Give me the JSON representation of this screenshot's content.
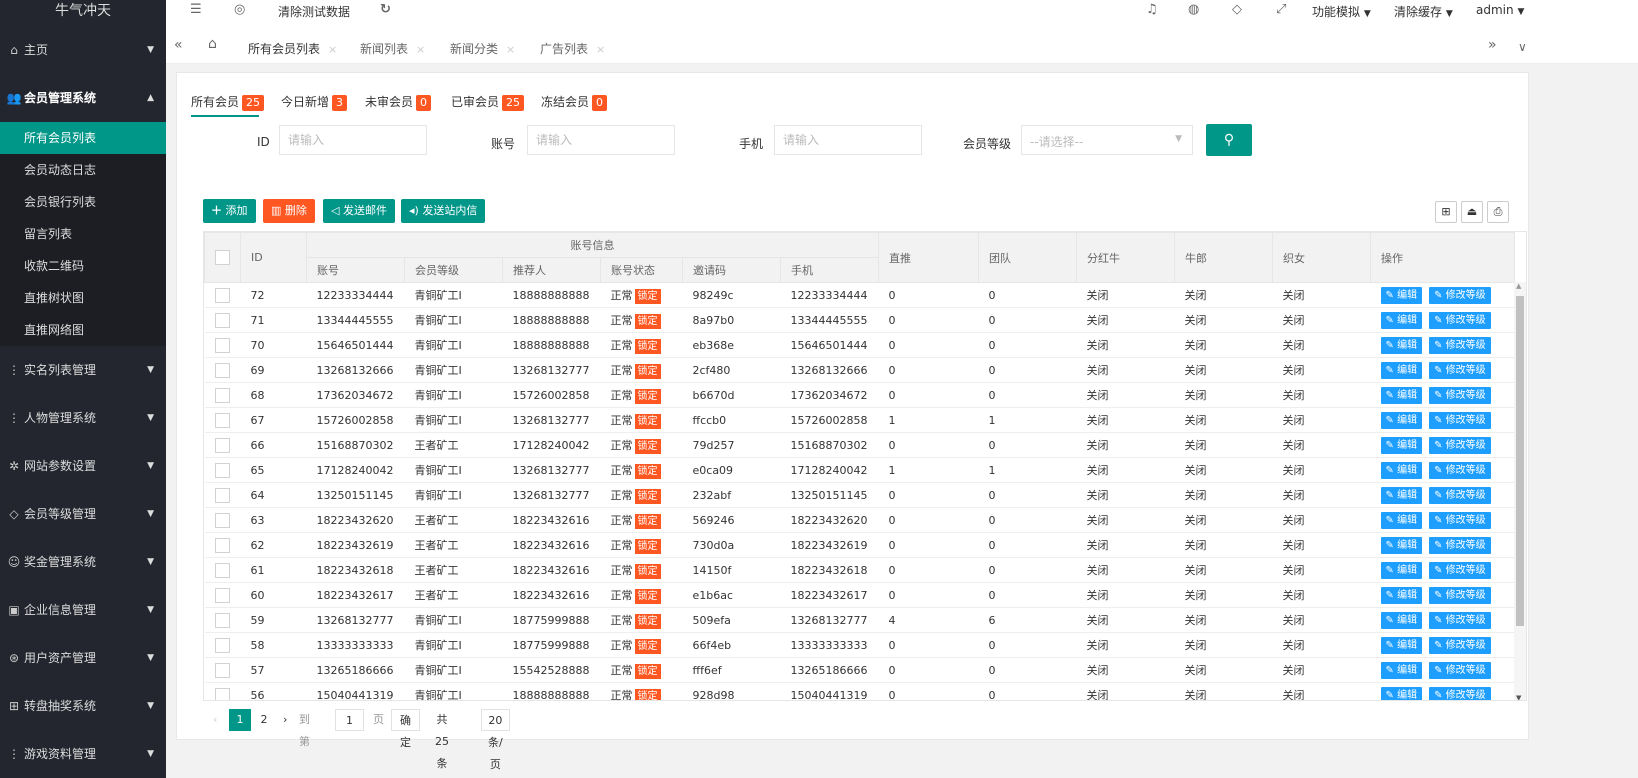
{
  "app": {
    "title": "牛气冲天"
  },
  "header": {
    "clear_test_data": "清除测试数据",
    "func_sim": "功能模拟",
    "clear_cache": "清除缓存",
    "user": "admin"
  },
  "sidebar": {
    "home": "主页",
    "member_system": "会员管理系统",
    "sub_items": [
      "所有会员列表",
      "会员动态日志",
      "会员银行列表",
      "留言列表",
      "收款二维码",
      "直推树状图",
      "直推网络图"
    ],
    "groups": [
      "实名列表管理",
      "人物管理系统",
      "网站参数设置",
      "会员等级管理",
      "奖金管理系统",
      "企业信息管理",
      "用户资产管理",
      "转盘抽奖系统",
      "游戏资料管理"
    ]
  },
  "tabs": [
    "所有会员列表",
    "新闻列表",
    "新闻分类",
    "广告列表"
  ],
  "status_tabs": [
    {
      "label": "所有会员",
      "count": "25"
    },
    {
      "label": "今日新增",
      "count": "3"
    },
    {
      "label": "未审会员",
      "count": "0"
    },
    {
      "label": "已审会员",
      "count": "25"
    },
    {
      "label": "冻结会员",
      "count": "0"
    }
  ],
  "filters": {
    "id_label": "ID",
    "account_label": "账号",
    "phone_label": "手机",
    "level_label": "会员等级",
    "placeholder": "请输入",
    "select_placeholder": "--请选择--"
  },
  "toolbar": {
    "add": "添加",
    "delete": "删除",
    "send_mail": "发送邮件",
    "send_msg": "发送站内信"
  },
  "table": {
    "group_header": "账号信息",
    "headers": {
      "id": "ID",
      "account": "账号",
      "level": "会员等级",
      "referrer": "推荐人",
      "status": "账号状态",
      "invite": "邀请码",
      "phone": "手机",
      "direct": "直推",
      "team": "团队",
      "bonus": "分红牛",
      "cowherd": "牛郎",
      "weaver": "织女",
      "ops": "操作"
    },
    "status_normal": "正常",
    "status_lock": "锁定",
    "closed": "关闭",
    "edit_btn": "编辑",
    "level_btn": "修改等级",
    "rows": [
      [
        "72",
        "12233334444",
        "青铜矿工I",
        "18888888888",
        "98249c",
        "12233334444",
        "0",
        "0"
      ],
      [
        "71",
        "13344445555",
        "青铜矿工I",
        "18888888888",
        "8a97b0",
        "13344445555",
        "0",
        "0"
      ],
      [
        "70",
        "15646501444",
        "青铜矿工I",
        "18888888888",
        "eb368e",
        "15646501444",
        "0",
        "0"
      ],
      [
        "69",
        "13268132666",
        "青铜矿工I",
        "13268132777",
        "2cf480",
        "13268132666",
        "0",
        "0"
      ],
      [
        "68",
        "17362034672",
        "青铜矿工I",
        "15726002858",
        "b6670d",
        "17362034672",
        "0",
        "0"
      ],
      [
        "67",
        "15726002858",
        "青铜矿工I",
        "13268132777",
        "ffccb0",
        "15726002858",
        "1",
        "1"
      ],
      [
        "66",
        "15168870302",
        "王者矿工",
        "17128240042",
        "79d257",
        "15168870302",
        "0",
        "0"
      ],
      [
        "65",
        "17128240042",
        "青铜矿工I",
        "13268132777",
        "e0ca09",
        "17128240042",
        "1",
        "1"
      ],
      [
        "64",
        "13250151145",
        "青铜矿工I",
        "13268132777",
        "232abf",
        "13250151145",
        "0",
        "0"
      ],
      [
        "63",
        "18223432620",
        "王者矿工",
        "18223432616",
        "569246",
        "18223432620",
        "0",
        "0"
      ],
      [
        "62",
        "18223432619",
        "王者矿工",
        "18223432616",
        "730d0a",
        "18223432619",
        "0",
        "0"
      ],
      [
        "61",
        "18223432618",
        "王者矿工",
        "18223432616",
        "14150f",
        "18223432618",
        "0",
        "0"
      ],
      [
        "60",
        "18223432617",
        "王者矿工",
        "18223432616",
        "e1b6ac",
        "18223432617",
        "0",
        "0"
      ],
      [
        "59",
        "13268132777",
        "青铜矿工I",
        "18775999888",
        "509efa",
        "13268132777",
        "4",
        "6"
      ],
      [
        "58",
        "13333333333",
        "青铜矿工I",
        "18775999888",
        "66f4eb",
        "13333333333",
        "0",
        "0"
      ],
      [
        "57",
        "13265186666",
        "青铜矿工I",
        "15542528888",
        "fff6ef",
        "13265186666",
        "0",
        "0"
      ],
      [
        "56",
        "15040441319",
        "青铜矿工I",
        "18888888888",
        "928d98",
        "15040441319",
        "0",
        "0"
      ]
    ]
  },
  "pager": {
    "page1": "1",
    "page2": "2",
    "goto": "到第",
    "page_input": "1",
    "page_unit": "页",
    "confirm": "确定",
    "total": "共 25 条",
    "per_page": "20 条/页"
  },
  "colors": {
    "primary": "#009688",
    "danger": "#ff5722",
    "info": "#1e9fff",
    "sidebar": "#23262e"
  }
}
